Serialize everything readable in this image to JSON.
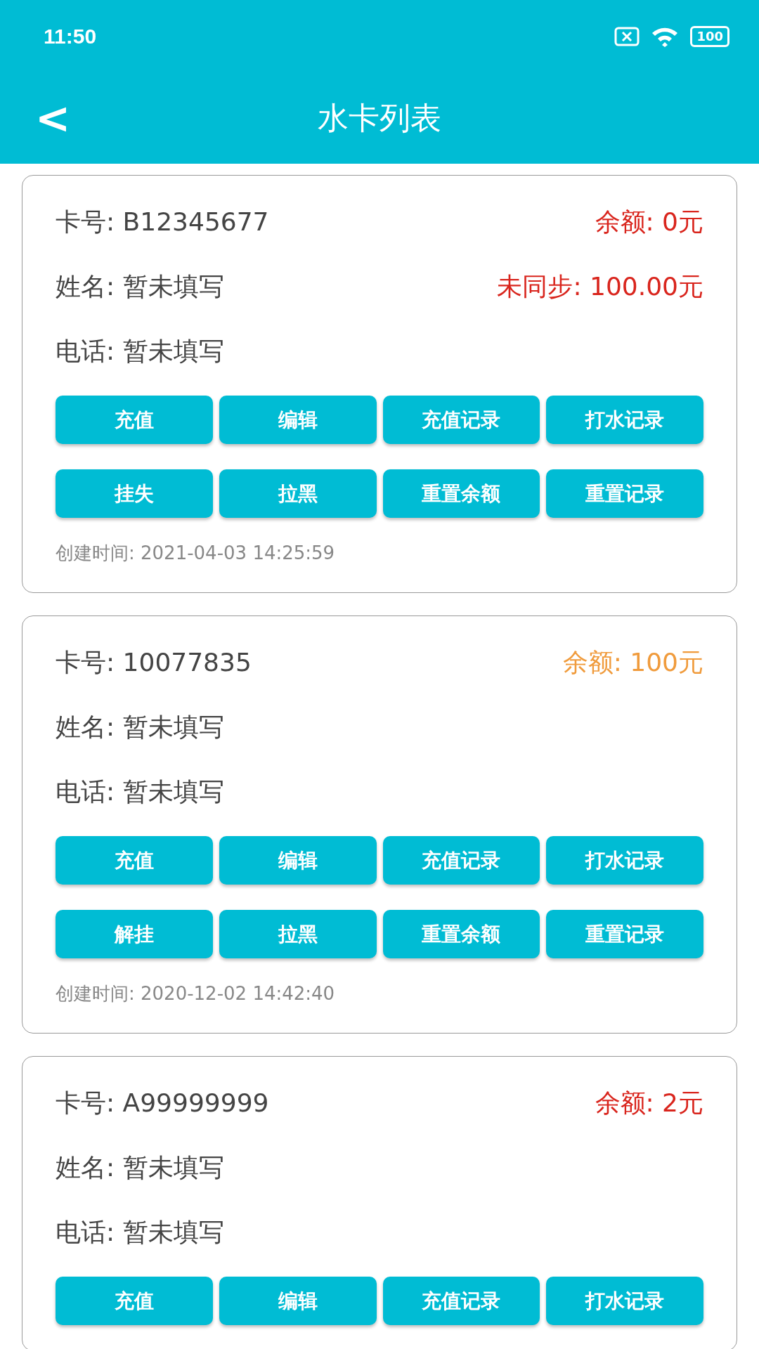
{
  "status_bar": {
    "time": "11:50",
    "battery": "100"
  },
  "header": {
    "back": "<",
    "title": "水卡列表"
  },
  "cards": [
    {
      "card_no": "卡号: B12345677",
      "balance": {
        "text": "余额: 0元",
        "color": "#d9251d"
      },
      "unsynced": "未同步: 100.00元",
      "name": "姓名: 暂未填写",
      "phone": "电话: 暂未填写",
      "button_rows": [
        [
          "充值",
          "编辑",
          "充值记录",
          "打水记录"
        ],
        [
          "挂失",
          "拉黑",
          "重置余额",
          "重置记录"
        ]
      ],
      "created": "创建时间: 2021-04-03 14:25:59"
    },
    {
      "card_no": "卡号: 10077835",
      "balance": {
        "text": "余额: 100元",
        "color": "#f09b3c"
      },
      "name": "姓名: 暂未填写",
      "phone": "电话: 暂未填写",
      "button_rows": [
        [
          "充值",
          "编辑",
          "充值记录",
          "打水记录"
        ],
        [
          "解挂",
          "拉黑",
          "重置余额",
          "重置记录"
        ]
      ],
      "created": "创建时间: 2020-12-02 14:42:40"
    },
    {
      "card_no": "卡号: A99999999",
      "balance": {
        "text": "余额: 2元",
        "color": "#d9251d"
      },
      "name": "姓名: 暂未填写",
      "phone": "电话: 暂未填写",
      "button_rows": [
        [
          "充值",
          "编辑",
          "充值记录",
          "打水记录"
        ]
      ]
    }
  ]
}
